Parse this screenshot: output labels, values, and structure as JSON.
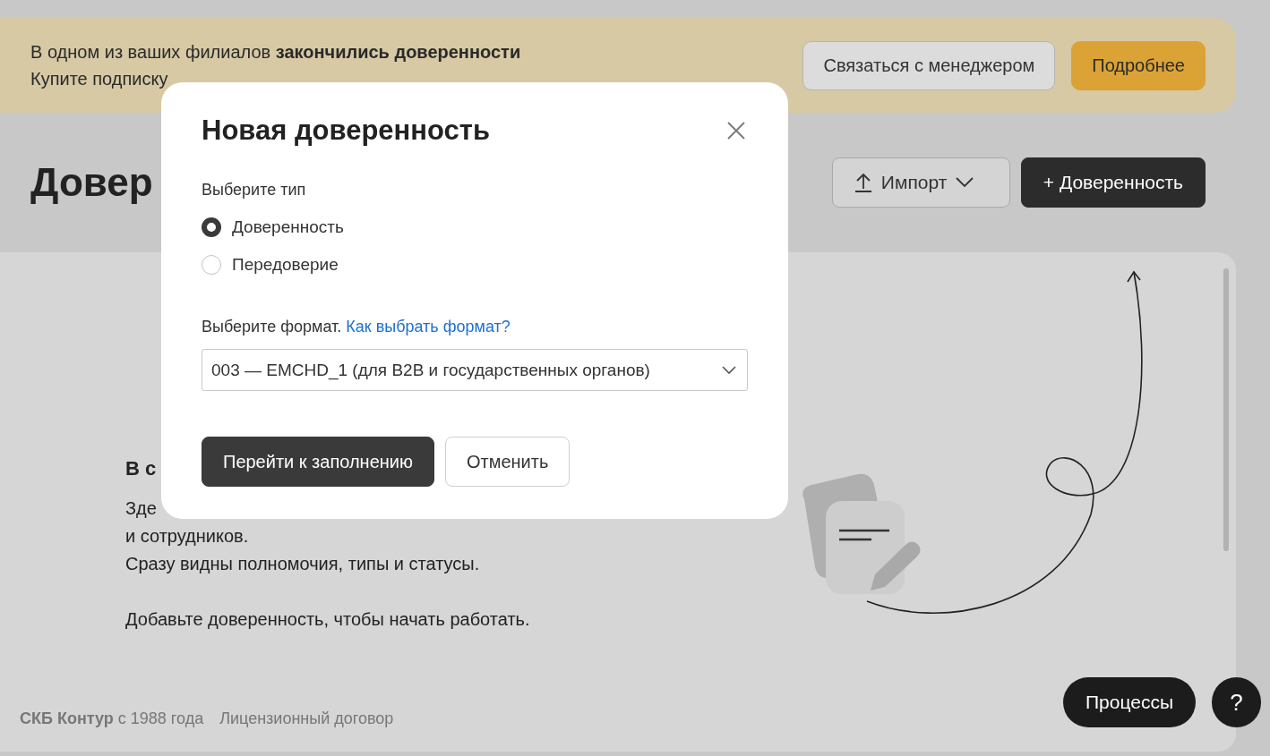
{
  "banner": {
    "title": "В одном из ваших филиалов **закончились доверенности**",
    "text": "Купите подписку",
    "buttons": [
      {
        "label": "Связаться с менеджером",
        "kind": "secondary"
      },
      {
        "label": "Подробнее",
        "kind": "accent"
      }
    ]
  },
  "page": {
    "title": "Довер",
    "actions": [
      {
        "label": "Импорт",
        "kind": "import"
      },
      {
        "label": "+ Доверенность",
        "kind": "primary"
      }
    ]
  },
  "empty_state": {
    "title": "В с",
    "paragraphs": [
      [
        "Зде",
        "и сотрудников.",
        "Сразу видны полномочия, типы и статусы."
      ],
      [
        "Добавьте доверенность, чтобы начать работать."
      ]
    ]
  },
  "footer": {
    "brand": "СКБ Контур",
    "since": "с 1988 года",
    "link": "Лицензионный договор"
  },
  "floating": {
    "processes": "Процессы",
    "help": "?"
  },
  "dialog": {
    "title": "Новая доверенность",
    "type_label": "Выберите тип",
    "types": [
      {
        "label": "Доверенность",
        "selected": true
      },
      {
        "label": "Передоверие",
        "selected": false
      }
    ],
    "format_label": "Выберите формат.",
    "format_help_link": "Как выбрать формат?",
    "format_value": "003 — EMCHD_1 (для B2B и государственных органов)",
    "buttons": [
      {
        "label": "Перейти к заполнению",
        "kind": "primary"
      },
      {
        "label": "Отменить",
        "kind": "secondary"
      }
    ]
  }
}
